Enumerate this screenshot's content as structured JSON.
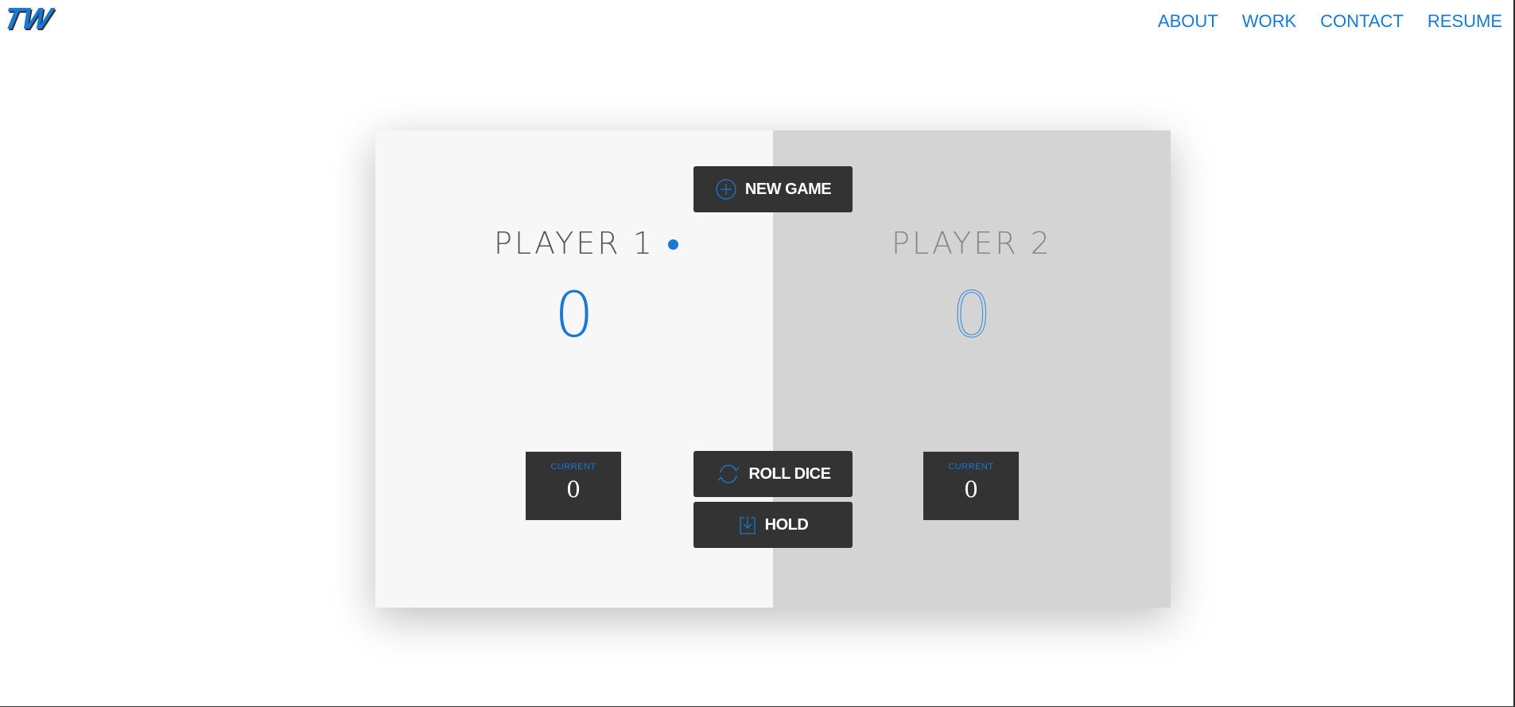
{
  "logo": {
    "text": "TW"
  },
  "nav": {
    "items": [
      "ABOUT",
      "WORK",
      "CONTACT",
      "RESUME"
    ]
  },
  "game": {
    "new_game_label": "NEW GAME",
    "roll_dice_label": "ROLL DICE",
    "hold_label": "HOLD",
    "players": [
      {
        "name": "PLAYER 1",
        "score": "0",
        "current_label": "CURRENT",
        "current_value": "0",
        "active": true
      },
      {
        "name": "PLAYER 2",
        "score": "0",
        "current_label": "CURRENT",
        "current_value": "0",
        "active": false
      }
    ]
  },
  "colors": {
    "accent": "#1778d6",
    "button_bg": "#333333",
    "panel_left": "#f7f7f7",
    "panel_right": "#d4d4d4"
  },
  "icons": {
    "new_game": "plus-circle-icon",
    "roll_dice": "refresh-icon",
    "hold": "download-icon"
  }
}
